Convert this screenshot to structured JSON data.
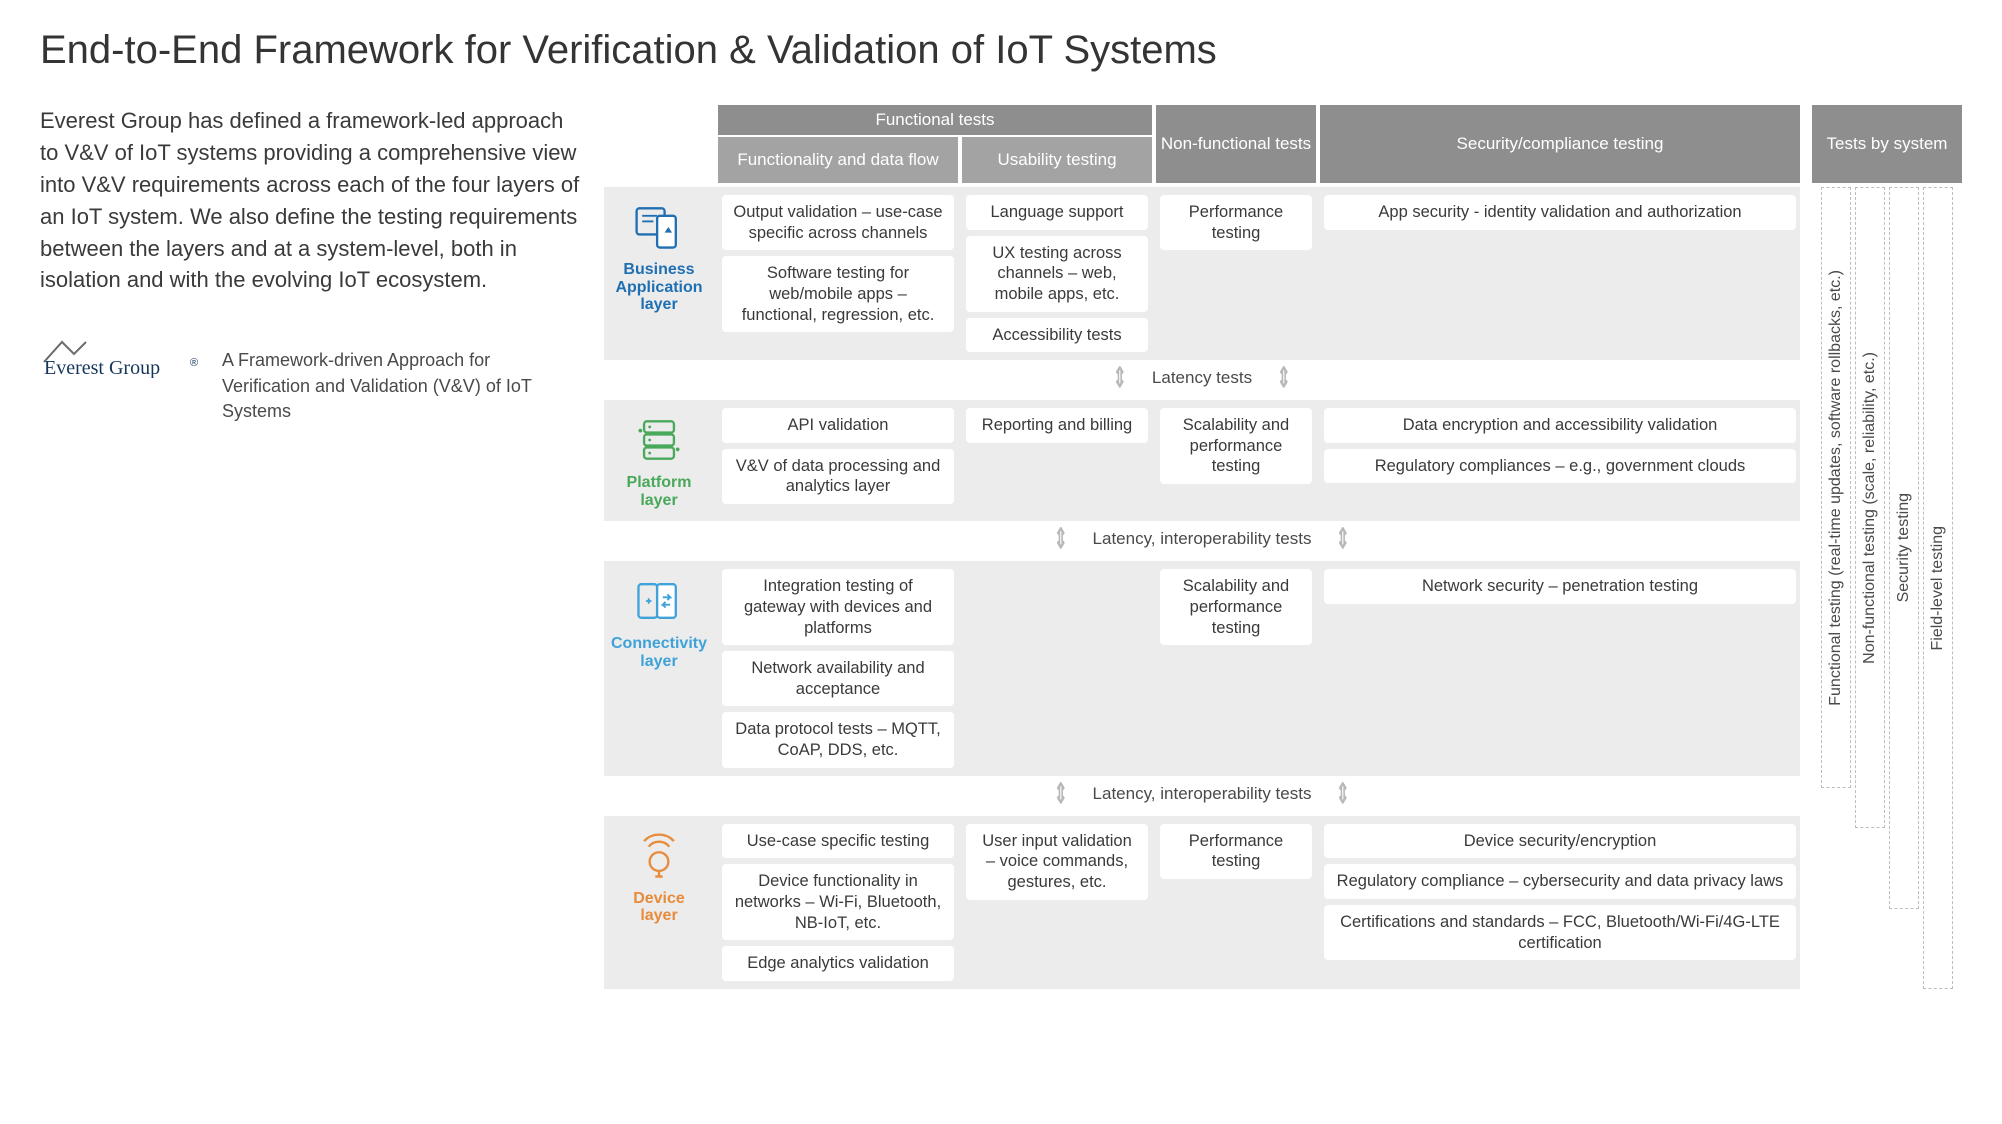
{
  "title": "End-to-End Framework for Verification & Validation of IoT Systems",
  "intro": "Everest Group has defined a framework-led approach to V&V of IoT systems providing a comprehensive view into V&V requirements across each of the four layers of an IoT system. We also define the testing requirements between the layers and at a system-level, both in isolation and with the evolving IoT ecosystem.",
  "logo_text": "Everest Group®",
  "logo_caption": "A Framework-driven Approach for Verification and Validation (V&V) of IoT Systems",
  "headers": {
    "functional_group": "Functional tests",
    "functionality": "Functionality and data flow",
    "usability": "Usability testing",
    "nonfunctional": "Non-functional tests",
    "security": "Security/compliance testing",
    "tests_by_system": "Tests by system"
  },
  "layers": [
    {
      "name": "Business Application layer",
      "color_class": "c-business",
      "icon": "business",
      "functionality": [
        "Output validation – use-case specific across channels",
        "Software testing for web/mobile apps – functional, regression, etc."
      ],
      "usability": [
        "Language support",
        "UX testing across channels – web, mobile apps, etc.",
        "Accessibility tests"
      ],
      "nonfunctional": [
        "Performance testing"
      ],
      "security": [
        "App security - identity validation and authorization"
      ]
    },
    {
      "name": "Platform layer",
      "color_class": "c-platform",
      "icon": "platform",
      "functionality": [
        "API validation",
        "V&V of data processing and analytics layer"
      ],
      "usability": [
        "Reporting and billing"
      ],
      "nonfunctional": [
        "Scalability and performance testing"
      ],
      "security": [
        "Data encryption and accessibility validation",
        "Regulatory compliances – e.g., government clouds"
      ]
    },
    {
      "name": "Connectivity layer",
      "color_class": "c-connectivity",
      "icon": "connectivity",
      "functionality": [
        "Integration testing of gateway with devices and platforms",
        "Network availability and acceptance",
        "Data protocol tests – MQTT, CoAP, DDS, etc."
      ],
      "usability": [],
      "nonfunctional": [
        "Scalability and performance testing"
      ],
      "security": [
        "Network security – penetration testing"
      ]
    },
    {
      "name": "Device layer",
      "color_class": "c-device",
      "icon": "device",
      "functionality": [
        "Use-case specific testing",
        "Device functionality in networks – Wi-Fi, Bluetooth, NB-IoT, etc.",
        "Edge analytics validation"
      ],
      "usability": [
        "User input validation – voice commands, gestures, etc."
      ],
      "nonfunctional": [
        "Performance testing"
      ],
      "security": [
        "Device security/encryption",
        "Regulatory compliance – cybersecurity and data privacy laws",
        "Certifications and standards – FCC, Bluetooth/Wi-Fi/4G-LTE certification"
      ]
    }
  ],
  "between": [
    "Latency tests",
    "Latency, interoperability tests",
    "Latency, interoperability tests"
  ],
  "side_labels": [
    "Functional testing (real-time updates, software rollbacks, etc.)",
    "Non-functional testing (scale, reliability, etc.)",
    "Security testing",
    "Field-level testing"
  ]
}
